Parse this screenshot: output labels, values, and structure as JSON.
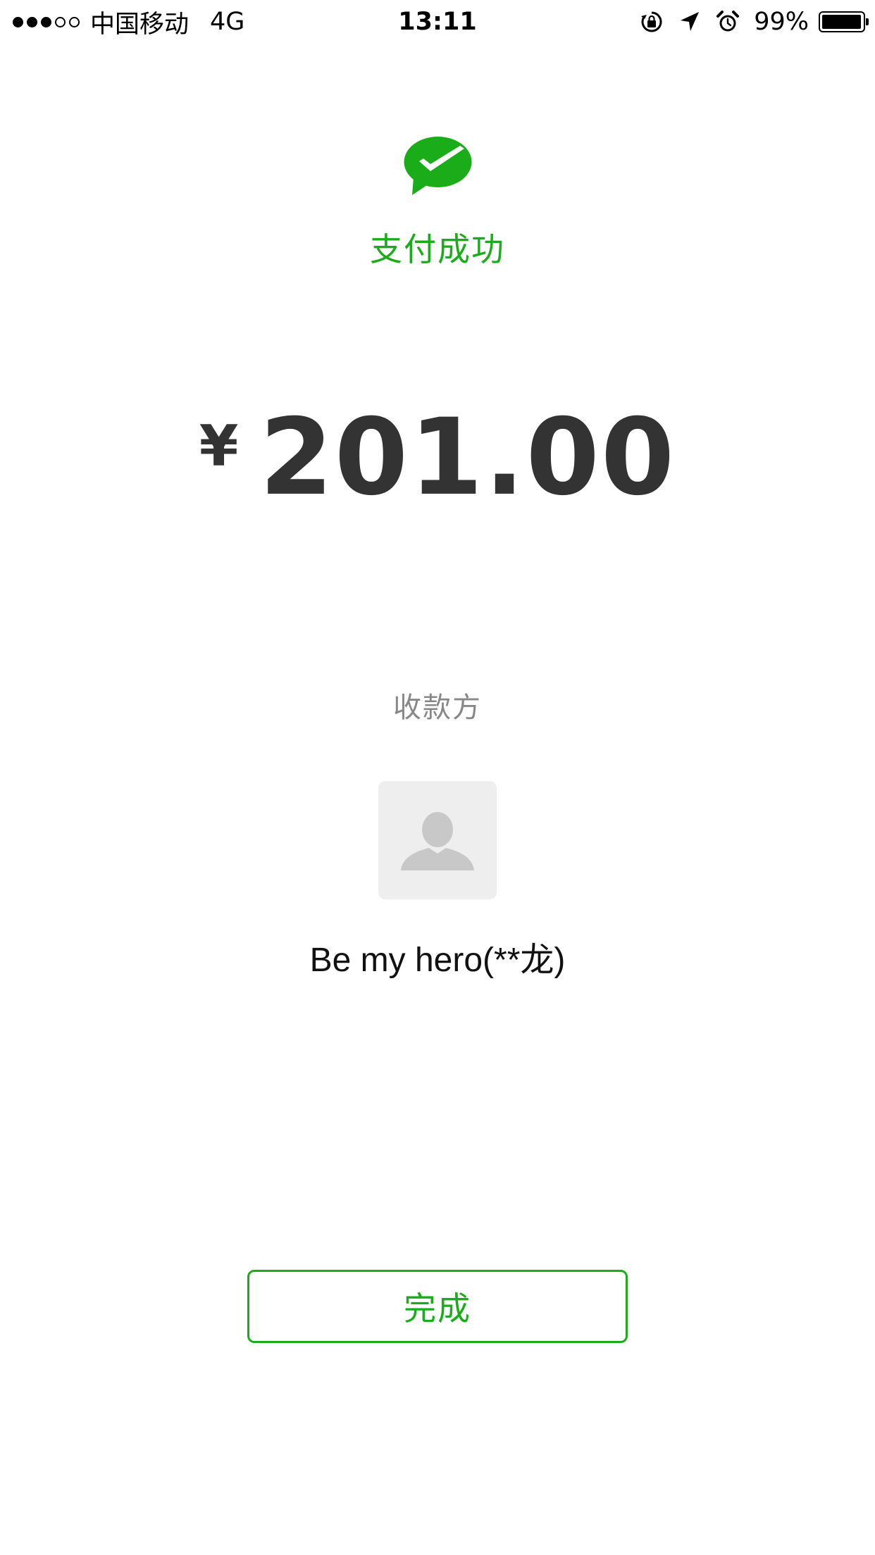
{
  "status_bar": {
    "signal_bars_filled": 3,
    "signal_bars_total": 5,
    "carrier": "中国移动",
    "network": "4G",
    "time": "13:11",
    "icons": [
      "rotation-lock-icon",
      "location-arrow-icon",
      "alarm-icon"
    ],
    "battery_percent": "99%",
    "battery_level": 0.99
  },
  "result": {
    "icon": "wechat-pay-success-icon",
    "title": "支付成功",
    "accent_color": "#1aad19"
  },
  "payment": {
    "currency_symbol": "¥",
    "amount": "201.00"
  },
  "payee": {
    "label": "收款方",
    "avatar_icon": "default-avatar-icon",
    "name": "Be my hero(**龙)"
  },
  "actions": {
    "done_label": "完成"
  }
}
